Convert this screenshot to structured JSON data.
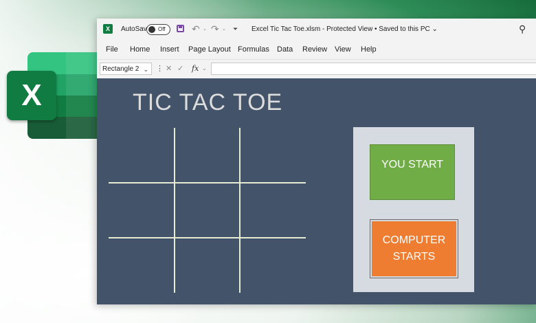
{
  "titlebar": {
    "app_icon": "excel-icon",
    "autosave_label": "AutoSave",
    "autosave_state": "Off",
    "save_icon": "save-icon",
    "undo_icon": "undo-icon",
    "redo_icon": "redo-icon",
    "customize_icon": "customize-toolbar-icon",
    "document_title": "Excel Tic Tac Toe.xlsm  -  Protected View  •  Saved to this PC ⌄",
    "search_icon": "search-icon"
  },
  "menu": {
    "items": [
      "File",
      "Home",
      "Insert",
      "Page Layout",
      "Formulas",
      "Data",
      "Review",
      "View",
      "Help"
    ]
  },
  "formula_bar": {
    "name_box": "Rectangle 2",
    "fx_label": "fx",
    "formula_value": ""
  },
  "sheet": {
    "title": "TIC TAC TOE",
    "you_start_button": "YOU START",
    "computer_starts_button": "COMPUTER\nSTARTS",
    "colors": {
      "sheet_bg": "#435369",
      "grid_lines": "#e6ecd2",
      "panel_bg": "#d6dbe1",
      "you_start": "#71ad47",
      "computer_starts": "#ee7d31"
    }
  },
  "logo": {
    "letter": "X",
    "icon": "excel-logo-icon"
  }
}
